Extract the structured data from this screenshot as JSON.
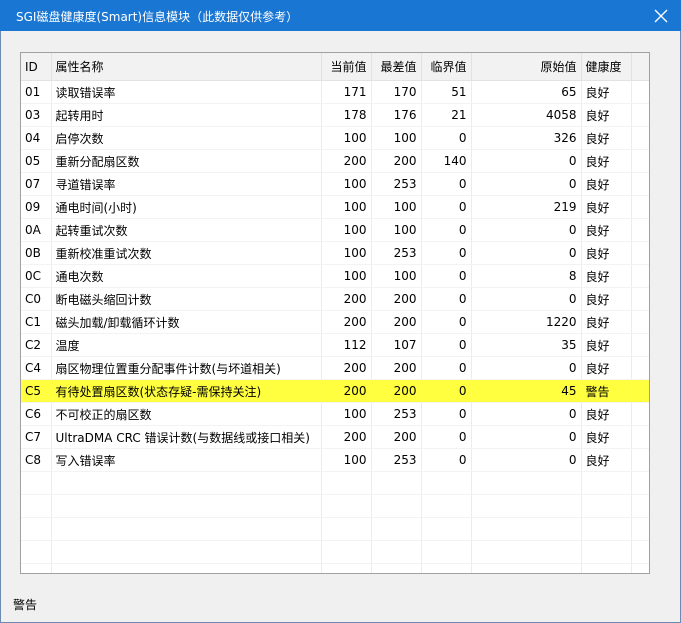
{
  "window": {
    "title": "SGI磁盘健康度(Smart)信息模块（此数据仅供参考）",
    "close_icon": "close-icon"
  },
  "table": {
    "columns": [
      "ID",
      "属性名称",
      "当前值",
      "最差值",
      "临界值",
      "原始值",
      "健康度"
    ],
    "rows": [
      {
        "id": "01",
        "name": "读取错误率",
        "current": "171",
        "worst": "170",
        "threshold": "51",
        "raw": "65",
        "health": "良好"
      },
      {
        "id": "03",
        "name": "起转用时",
        "current": "178",
        "worst": "176",
        "threshold": "21",
        "raw": "4058",
        "health": "良好"
      },
      {
        "id": "04",
        "name": "启停次数",
        "current": "100",
        "worst": "100",
        "threshold": "0",
        "raw": "326",
        "health": "良好"
      },
      {
        "id": "05",
        "name": "重新分配扇区数",
        "current": "200",
        "worst": "200",
        "threshold": "140",
        "raw": "0",
        "health": "良好"
      },
      {
        "id": "07",
        "name": "寻道错误率",
        "current": "100",
        "worst": "253",
        "threshold": "0",
        "raw": "0",
        "health": "良好"
      },
      {
        "id": "09",
        "name": "通电时间(小时)",
        "current": "100",
        "worst": "100",
        "threshold": "0",
        "raw": "219",
        "health": "良好"
      },
      {
        "id": "0A",
        "name": "起转重试次数",
        "current": "100",
        "worst": "100",
        "threshold": "0",
        "raw": "0",
        "health": "良好"
      },
      {
        "id": "0B",
        "name": "重新校准重试次数",
        "current": "100",
        "worst": "253",
        "threshold": "0",
        "raw": "0",
        "health": "良好"
      },
      {
        "id": "0C",
        "name": "通电次数",
        "current": "100",
        "worst": "100",
        "threshold": "0",
        "raw": "8",
        "health": "良好"
      },
      {
        "id": "C0",
        "name": "断电磁头缩回计数",
        "current": "200",
        "worst": "200",
        "threshold": "0",
        "raw": "0",
        "health": "良好"
      },
      {
        "id": "C1",
        "name": "磁头加载/卸载循环计数",
        "current": "200",
        "worst": "200",
        "threshold": "0",
        "raw": "1220",
        "health": "良好"
      },
      {
        "id": "C2",
        "name": "温度",
        "current": "112",
        "worst": "107",
        "threshold": "0",
        "raw": "35",
        "health": "良好"
      },
      {
        "id": "C4",
        "name": "扇区物理位置重分配事件计数(与坏道相关)",
        "current": "200",
        "worst": "200",
        "threshold": "0",
        "raw": "0",
        "health": "良好"
      },
      {
        "id": "C5",
        "name": "有待处置扇区数(状态存疑-需保持关注)",
        "current": "200",
        "worst": "200",
        "threshold": "0",
        "raw": "45",
        "health": "警告",
        "highlight": true
      },
      {
        "id": "C6",
        "name": "不可校正的扇区数",
        "current": "100",
        "worst": "253",
        "threshold": "0",
        "raw": "0",
        "health": "良好"
      },
      {
        "id": "C7",
        "name": "UltraDMA CRC 错误计数(与数据线或接口相关)",
        "current": "200",
        "worst": "200",
        "threshold": "0",
        "raw": "0",
        "health": "良好"
      },
      {
        "id": "C8",
        "name": "写入错误率",
        "current": "100",
        "worst": "253",
        "threshold": "0",
        "raw": "0",
        "health": "良好"
      }
    ]
  },
  "status": {
    "text": "警告"
  },
  "colors": {
    "titlebar": "#1976d2",
    "highlight": "#ffff40"
  }
}
